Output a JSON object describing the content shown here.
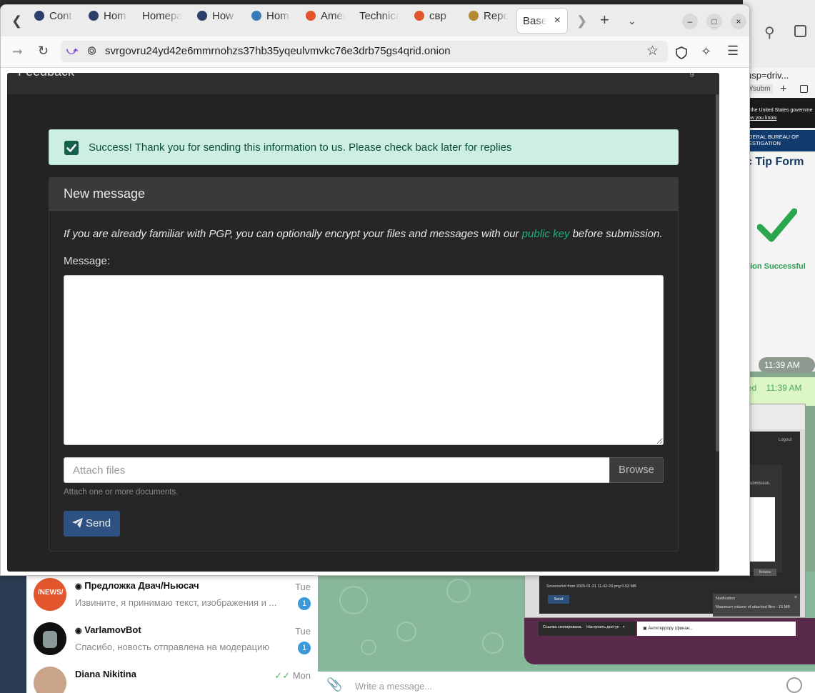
{
  "browser": {
    "tabs": [
      {
        "label": "Cont",
        "favicon": "fbi-seal"
      },
      {
        "label": "Hom",
        "favicon": "fbi-seal"
      },
      {
        "label": "Homepa",
        "favicon": ""
      },
      {
        "label": "How",
        "favicon": "fbi-seal"
      },
      {
        "label": "Hom",
        "favicon": "globe-seal"
      },
      {
        "label": "Amer",
        "favicon": "duckduckgo"
      },
      {
        "label": "Technica",
        "favicon": ""
      },
      {
        "label": "свр",
        "favicon": "duckduckgo"
      },
      {
        "label": "Repo",
        "favicon": "eagle-emblem"
      }
    ],
    "active_tab": {
      "label": "Base",
      "close": "×"
    },
    "url": "svrgovru24yd42e6mmrnohzs37hb35yqeulvmvkc76e3drb75gs4qrid.onion",
    "window_controls": {
      "minimize": "–",
      "maximize": "□",
      "close": "×"
    }
  },
  "page": {
    "alert": {
      "text": "Success! Thank you for sending this information to us. Please check back later for replies"
    },
    "card": {
      "title": "New message",
      "intro_before": "If you are already familiar with PGP, you can optionally encrypt your files and messages with our ",
      "intro_link": "public key",
      "intro_after": " before submission.",
      "message_label": "Message:",
      "message_value": "",
      "attach_placeholder": "Attach files",
      "browse_label": "Browse",
      "help_text": "Attach one or more documents.",
      "send_label": "Send"
    }
  },
  "background_browser": {
    "url_fragment": "usp=driv...",
    "url_fragment2": "w/subm",
    "gov_banner": "of the United States governme",
    "gov_banner_link": "how you know",
    "agency_line1": "EDERAL BUREAU OF",
    "agency_line2": "VESTIGATION",
    "form_title": "c Tip Form",
    "success_text": "sion Successful"
  },
  "chat": {
    "items": [
      {
        "name": "Предложка Двач/Ньюсач",
        "time": "Tue",
        "preview": "Извините, я принимаю текст, изображения и ...",
        "badge": "1",
        "avatar_text": "/NEWS/",
        "bot": true
      },
      {
        "name": "VarlamovBot",
        "time": "Tue",
        "preview": "Спасибо, новость отправлена на модерацию",
        "badge": "1",
        "avatar_text": "",
        "bot": true
      },
      {
        "name": "Diana Nikitina",
        "time": "Mon",
        "preview": "",
        "badge": "",
        "avatar_text": "",
        "bot": false
      }
    ],
    "compose_placeholder": "Write a message...",
    "times": [
      "11:39 AM",
      "11:39 AM"
    ],
    "time2_prefix": "ed"
  },
  "thumbnail": {
    "logout": "Logout",
    "submission": "ubmission.",
    "browse": "Browse",
    "file": "Screenshot from 2025-01-31 11-42-29.png 0.53 MB",
    "send": "Send",
    "notification_title": "Notification",
    "notification_text": "Maximum volume of attached files - 15 MB",
    "toast_text": "Ссылка скопирована.",
    "toast_action": "Настроить доступ",
    "file_chip": "Антитеррору (финан..."
  },
  "colors": {
    "modal_bg": "#232323",
    "alert_bg": "#cdeee2",
    "link_green": "#1fae7f",
    "send_blue": "#2d5282"
  }
}
